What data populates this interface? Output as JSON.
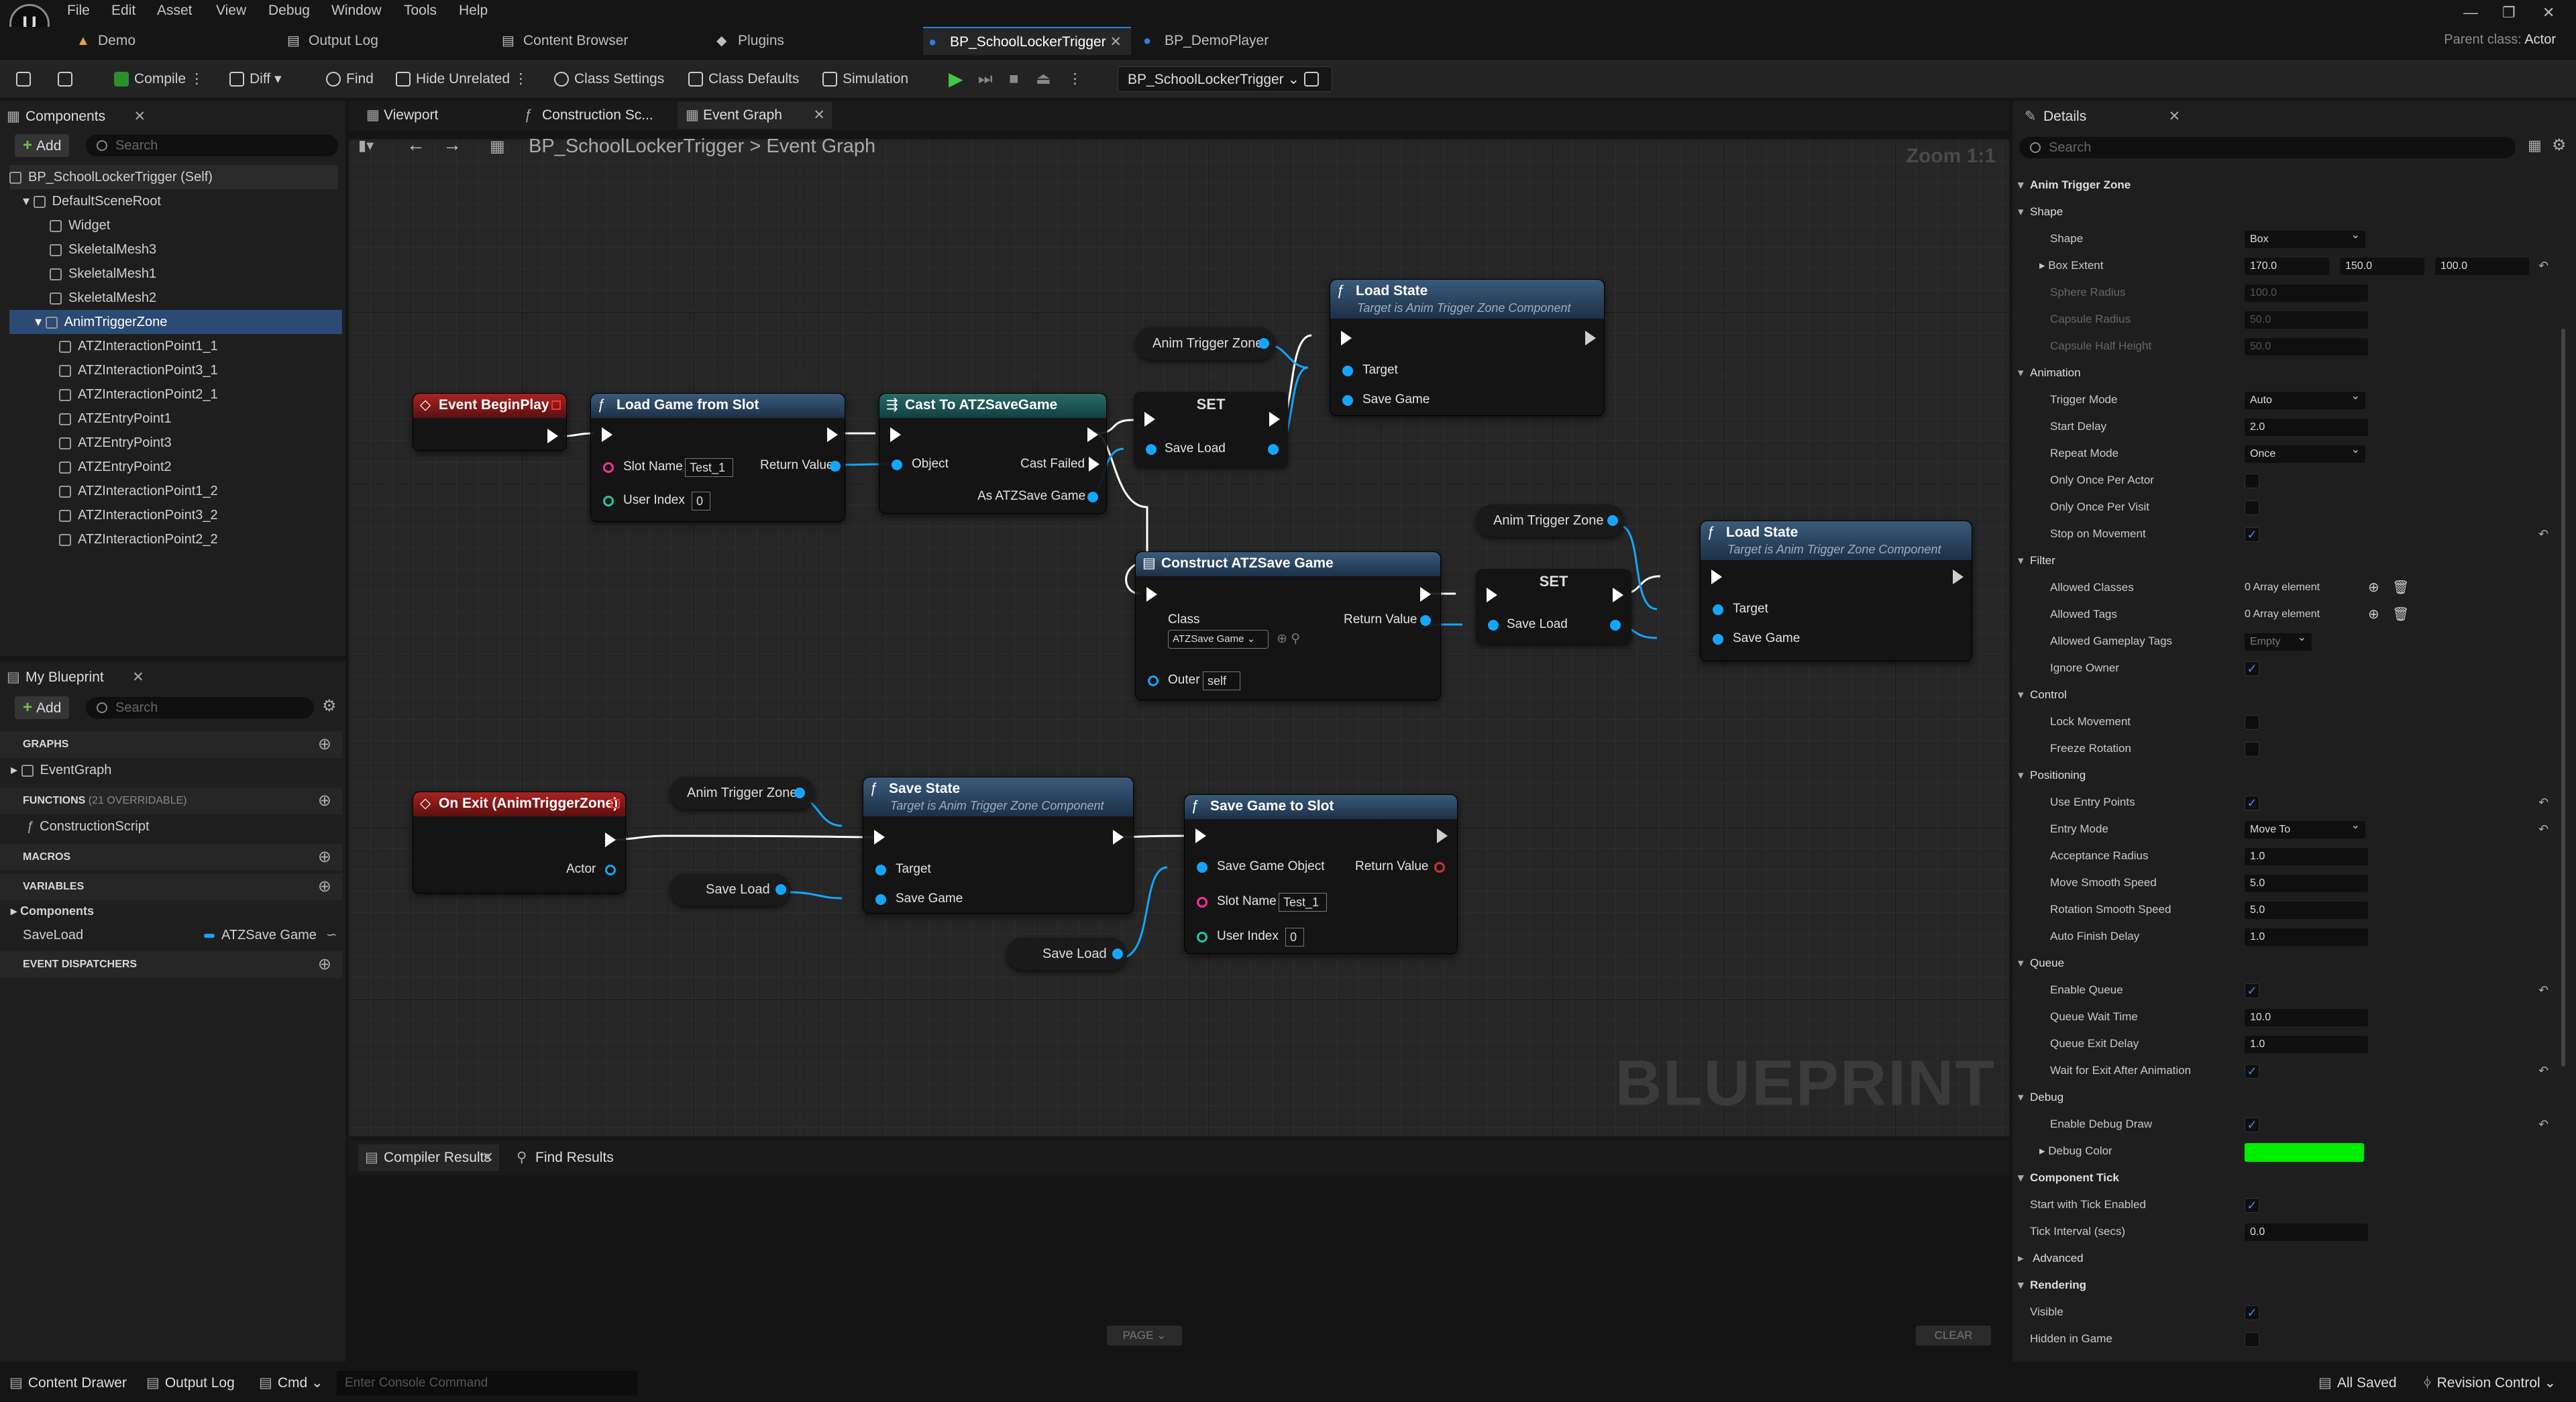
{
  "menu": [
    "File",
    "Edit",
    "Asset",
    "View",
    "Debug",
    "Window",
    "Tools",
    "Help"
  ],
  "doc_tabs": [
    "Demo",
    "Output Log",
    "Content Browser",
    "Plugins",
    "BP_SchoolLockerTrigger",
    "BP_DemoPlayer"
  ],
  "parent_class": {
    "label": "Parent class:",
    "value": "Actor"
  },
  "toolbar": {
    "compile": "Compile",
    "diff": "Diff",
    "find": "Find",
    "hide_unrelated": "Hide Unrelated",
    "class_settings": "Class Settings",
    "class_defaults": "Class Defaults",
    "simulation": "Simulation",
    "debug_object": "BP_SchoolLockerTrigger"
  },
  "components_panel": {
    "tab": "Components",
    "add": "Add",
    "search_placeholder": "Search",
    "tree": [
      "BP_SchoolLockerTrigger (Self)",
      "DefaultSceneRoot",
      "Widget",
      "SkeletalMesh3",
      "SkeletalMesh1",
      "SkeletalMesh2",
      "AnimTriggerZone",
      "ATZInteractionPoint1_1",
      "ATZInteractionPoint3_1",
      "ATZInteractionPoint2_1",
      "ATZEntryPoint1",
      "ATZEntryPoint3",
      "ATZEntryPoint2",
      "ATZInteractionPoint1_2",
      "ATZInteractionPoint3_2",
      "ATZInteractionPoint2_2"
    ]
  },
  "my_blueprint": {
    "tab": "My Blueprint",
    "add": "Add",
    "search_placeholder": "Search",
    "graphs": "GRAPHS",
    "event_graph": "EventGraph",
    "functions": "FUNCTIONS",
    "functions_count": "(21 OVERRIDABLE)",
    "construction_script": "ConstructionScript",
    "macros": "MACROS",
    "variables": "VARIABLES",
    "components_cat": "Components",
    "var_name": "SaveLoad",
    "var_type": "ATZSave Game",
    "dispatchers": "EVENT DISPATCHERS"
  },
  "graph_tabs": [
    "Viewport",
    "Construction Sc...",
    "Event Graph"
  ],
  "breadcrumb": {
    "bp": "BP_SchoolLockerTrigger",
    "sep": ">",
    "graph": "Event Graph",
    "zoom": "Zoom 1:1"
  },
  "watermark": "BLUEPRINT",
  "nodes": {
    "event_begin_play": "Event BeginPlay",
    "load_game_from_slot": {
      "title": "Load Game from Slot",
      "slot_name": "Slot Name",
      "slot_value": "Test_1",
      "user_index": "User Index",
      "user_index_value": "0",
      "return_value": "Return Value"
    },
    "cast": {
      "title": "Cast To ATZSaveGame",
      "object": "Object",
      "cast_failed": "Cast Failed",
      "as": "As ATZSave Game"
    },
    "set1": {
      "title": "SET",
      "pin": "Save Load"
    },
    "anim_zone_var": "Anim Trigger Zone",
    "load_state1": {
      "title": "Load State",
      "sub": "Target is Anim Trigger Zone Component",
      "target": "Target",
      "save_game": "Save Game"
    },
    "construct": {
      "title": "Construct ATZSave Game",
      "class": "Class",
      "class_value": "ATZSave Game",
      "return_value": "Return Value",
      "outer": "Outer",
      "outer_value": "self"
    },
    "set2": {
      "title": "SET",
      "pin": "Save Load"
    },
    "load_state2": {
      "title": "Load State",
      "sub": "Target is Anim Trigger Zone Component",
      "target": "Target",
      "save_game": "Save Game"
    },
    "on_exit": {
      "title": "On Exit (AnimTriggerZone)",
      "actor": "Actor"
    },
    "save_load_var": "Save Load",
    "save_state": {
      "title": "Save State",
      "sub": "Target is Anim Trigger Zone Component",
      "target": "Target",
      "save_game": "Save Game"
    },
    "save_game_to_slot": {
      "title": "Save Game to Slot",
      "save_game_object": "Save Game Object",
      "return_value": "Return Value",
      "slot_name": "Slot Name",
      "slot_value": "Test_1",
      "user_index": "User Index",
      "user_index_value": "0"
    }
  },
  "bottom_panel": {
    "compiler_results": "Compiler Results",
    "find_results": "Find Results",
    "page": "PAGE",
    "clear": "CLEAR"
  },
  "statusbar": {
    "content_drawer": "Content Drawer",
    "output_log": "Output Log",
    "cmd": "Cmd",
    "console_placeholder": "Enter Console Command",
    "all_saved": "All Saved",
    "revision_control": "Revision Control"
  },
  "details": {
    "tab": "Details",
    "search_placeholder": "Search",
    "title": "Anim Trigger Zone",
    "shape_cat": "Shape",
    "shape": "Shape",
    "shape_value": "Box",
    "box_extent": "Box Extent",
    "box_x": "170.0",
    "box_y": "150.0",
    "box_z": "100.0",
    "sphere_radius": "Sphere Radius",
    "sphere_value": "100.0",
    "capsule_radius": "Capsule Radius",
    "capsule_radius_value": "50.0",
    "capsule_half": "Capsule Half Height",
    "capsule_half_value": "50.0",
    "animation_cat": "Animation",
    "trigger_mode": "Trigger Mode",
    "trigger_mode_value": "Auto",
    "start_delay": "Start Delay",
    "start_delay_value": "2.0",
    "repeat_mode": "Repeat Mode",
    "repeat_mode_value": "Once",
    "only_once_actor": "Only Once Per Actor",
    "only_once_visit": "Only Once Per Visit",
    "stop_on_movement": "Stop on Movement",
    "filter_cat": "Filter",
    "allowed_classes": "Allowed Classes",
    "allowed_classes_value": "0 Array element",
    "allowed_tags": "Allowed Tags",
    "allowed_tags_value": "0 Array element",
    "allowed_gameplay_tags": "Allowed Gameplay Tags",
    "allowed_gameplay_tags_value": "Empty",
    "ignore_owner": "Ignore Owner",
    "control_cat": "Control",
    "lock_movement": "Lock Movement",
    "freeze_rotation": "Freeze Rotation",
    "positioning_cat": "Positioning",
    "use_entry_points": "Use Entry Points",
    "entry_mode": "Entry Mode",
    "entry_mode_value": "Move To",
    "acceptance_radius": "Acceptance Radius",
    "acceptance_radius_value": "1.0",
    "move_smooth": "Move Smooth Speed",
    "move_smooth_value": "5.0",
    "rotation_smooth": "Rotation Smooth Speed",
    "rotation_smooth_value": "5.0",
    "auto_finish": "Auto Finish Delay",
    "auto_finish_value": "1.0",
    "queue_cat": "Queue",
    "enable_queue": "Enable Queue",
    "queue_wait": "Queue Wait Time",
    "queue_wait_value": "10.0",
    "queue_exit": "Queue Exit Delay",
    "queue_exit_value": "1.0",
    "wait_exit": "Wait for Exit After Animation",
    "debug_cat": "Debug",
    "enable_debug": "Enable Debug Draw",
    "debug_color": "Debug Color",
    "debug_color_value": "#00ee00",
    "component_tick_cat": "Component Tick",
    "start_tick": "Start with Tick Enabled",
    "tick_interval": "Tick Interval (secs)",
    "tick_interval_value": "0.0",
    "advanced_cat": "Advanced",
    "rendering_cat": "Rendering",
    "visible": "Visible",
    "hidden_in_game": "Hidden in Game"
  }
}
